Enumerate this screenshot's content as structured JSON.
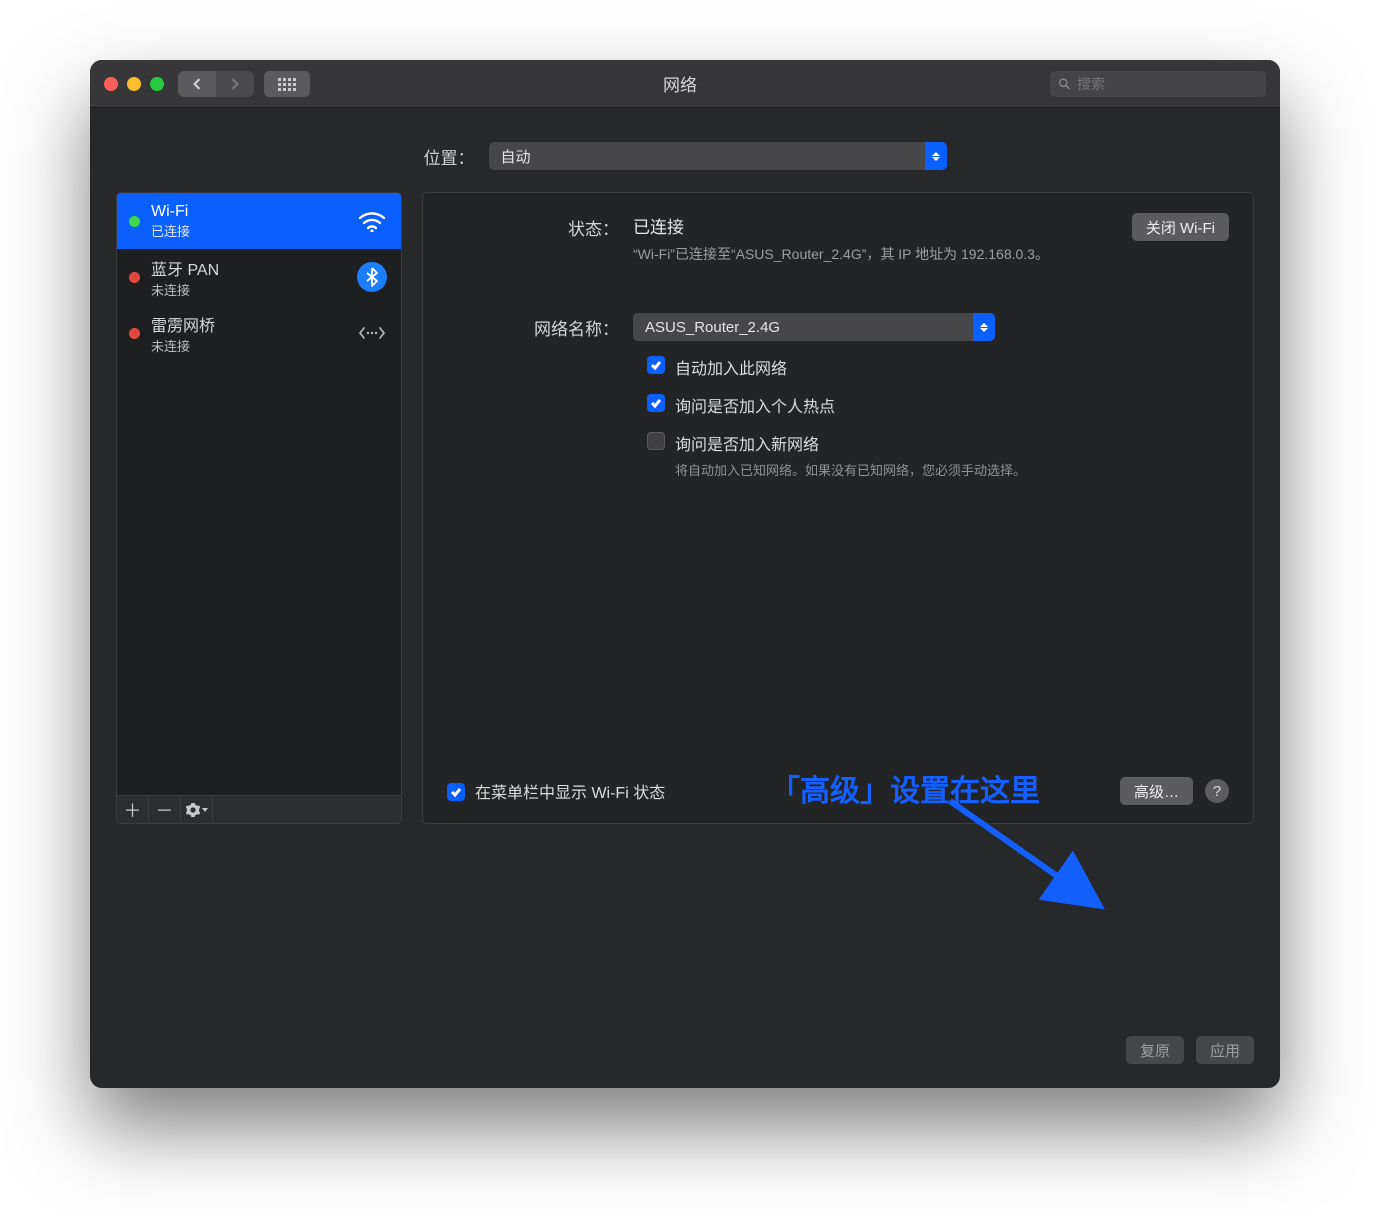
{
  "window": {
    "title": "网络"
  },
  "search": {
    "placeholder": "搜索"
  },
  "location": {
    "label": "位置：",
    "value": "自动"
  },
  "sidebar": {
    "items": [
      {
        "title": "Wi-Fi",
        "subtitle": "已连接",
        "status_color": "#3cd74b"
      },
      {
        "title": "蓝牙 PAN",
        "subtitle": "未连接",
        "status_color": "#e1483f"
      },
      {
        "title": "雷雳网桥",
        "subtitle": "未连接",
        "status_color": "#e1483f"
      }
    ]
  },
  "main": {
    "status_label": "状态：",
    "status_value": "已连接",
    "wifi_off_button": "关闭 Wi-Fi",
    "status_desc": "“Wi-Fi”已连接至“ASUS_Router_2.4G”，其 IP 地址为 192.168.0.3。",
    "network_name_label": "网络名称：",
    "network_name_value": "ASUS_Router_2.4G",
    "checkbox_autojoin": "自动加入此网络",
    "checkbox_hotspot": "询问是否加入个人热点",
    "checkbox_newnet": "询问是否加入新网络",
    "checkbox_newnet_desc": "将自动加入已知网络。如果没有已知网络，您必须手动选择。",
    "menubar_checkbox": "在菜单栏中显示 Wi-Fi 状态",
    "advanced_button": "高级…"
  },
  "footer": {
    "revert": "复原",
    "apply": "应用"
  },
  "annotation": {
    "text": "「高级」设置在这里"
  }
}
